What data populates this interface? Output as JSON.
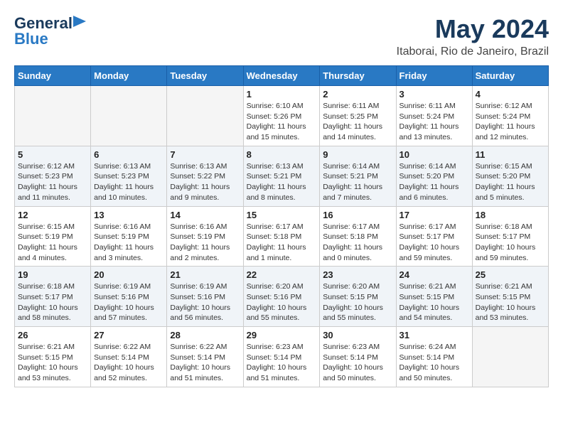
{
  "header": {
    "logo_general": "General",
    "logo_blue": "Blue",
    "title": "May 2024",
    "subtitle": "Itaborai, Rio de Janeiro, Brazil"
  },
  "weekdays": [
    "Sunday",
    "Monday",
    "Tuesday",
    "Wednesday",
    "Thursday",
    "Friday",
    "Saturday"
  ],
  "weeks": [
    [
      {
        "day": "",
        "sunrise": "",
        "sunset": "",
        "daylight": ""
      },
      {
        "day": "",
        "sunrise": "",
        "sunset": "",
        "daylight": ""
      },
      {
        "day": "",
        "sunrise": "",
        "sunset": "",
        "daylight": ""
      },
      {
        "day": "1",
        "sunrise": "Sunrise: 6:10 AM",
        "sunset": "Sunset: 5:26 PM",
        "daylight": "Daylight: 11 hours and 15 minutes."
      },
      {
        "day": "2",
        "sunrise": "Sunrise: 6:11 AM",
        "sunset": "Sunset: 5:25 PM",
        "daylight": "Daylight: 11 hours and 14 minutes."
      },
      {
        "day": "3",
        "sunrise": "Sunrise: 6:11 AM",
        "sunset": "Sunset: 5:24 PM",
        "daylight": "Daylight: 11 hours and 13 minutes."
      },
      {
        "day": "4",
        "sunrise": "Sunrise: 6:12 AM",
        "sunset": "Sunset: 5:24 PM",
        "daylight": "Daylight: 11 hours and 12 minutes."
      }
    ],
    [
      {
        "day": "5",
        "sunrise": "Sunrise: 6:12 AM",
        "sunset": "Sunset: 5:23 PM",
        "daylight": "Daylight: 11 hours and 11 minutes."
      },
      {
        "day": "6",
        "sunrise": "Sunrise: 6:13 AM",
        "sunset": "Sunset: 5:23 PM",
        "daylight": "Daylight: 11 hours and 10 minutes."
      },
      {
        "day": "7",
        "sunrise": "Sunrise: 6:13 AM",
        "sunset": "Sunset: 5:22 PM",
        "daylight": "Daylight: 11 hours and 9 minutes."
      },
      {
        "day": "8",
        "sunrise": "Sunrise: 6:13 AM",
        "sunset": "Sunset: 5:21 PM",
        "daylight": "Daylight: 11 hours and 8 minutes."
      },
      {
        "day": "9",
        "sunrise": "Sunrise: 6:14 AM",
        "sunset": "Sunset: 5:21 PM",
        "daylight": "Daylight: 11 hours and 7 minutes."
      },
      {
        "day": "10",
        "sunrise": "Sunrise: 6:14 AM",
        "sunset": "Sunset: 5:20 PM",
        "daylight": "Daylight: 11 hours and 6 minutes."
      },
      {
        "day": "11",
        "sunrise": "Sunrise: 6:15 AM",
        "sunset": "Sunset: 5:20 PM",
        "daylight": "Daylight: 11 hours and 5 minutes."
      }
    ],
    [
      {
        "day": "12",
        "sunrise": "Sunrise: 6:15 AM",
        "sunset": "Sunset: 5:19 PM",
        "daylight": "Daylight: 11 hours and 4 minutes."
      },
      {
        "day": "13",
        "sunrise": "Sunrise: 6:16 AM",
        "sunset": "Sunset: 5:19 PM",
        "daylight": "Daylight: 11 hours and 3 minutes."
      },
      {
        "day": "14",
        "sunrise": "Sunrise: 6:16 AM",
        "sunset": "Sunset: 5:19 PM",
        "daylight": "Daylight: 11 hours and 2 minutes."
      },
      {
        "day": "15",
        "sunrise": "Sunrise: 6:17 AM",
        "sunset": "Sunset: 5:18 PM",
        "daylight": "Daylight: 11 hours and 1 minute."
      },
      {
        "day": "16",
        "sunrise": "Sunrise: 6:17 AM",
        "sunset": "Sunset: 5:18 PM",
        "daylight": "Daylight: 11 hours and 0 minutes."
      },
      {
        "day": "17",
        "sunrise": "Sunrise: 6:17 AM",
        "sunset": "Sunset: 5:17 PM",
        "daylight": "Daylight: 10 hours and 59 minutes."
      },
      {
        "day": "18",
        "sunrise": "Sunrise: 6:18 AM",
        "sunset": "Sunset: 5:17 PM",
        "daylight": "Daylight: 10 hours and 59 minutes."
      }
    ],
    [
      {
        "day": "19",
        "sunrise": "Sunrise: 6:18 AM",
        "sunset": "Sunset: 5:17 PM",
        "daylight": "Daylight: 10 hours and 58 minutes."
      },
      {
        "day": "20",
        "sunrise": "Sunrise: 6:19 AM",
        "sunset": "Sunset: 5:16 PM",
        "daylight": "Daylight: 10 hours and 57 minutes."
      },
      {
        "day": "21",
        "sunrise": "Sunrise: 6:19 AM",
        "sunset": "Sunset: 5:16 PM",
        "daylight": "Daylight: 10 hours and 56 minutes."
      },
      {
        "day": "22",
        "sunrise": "Sunrise: 6:20 AM",
        "sunset": "Sunset: 5:16 PM",
        "daylight": "Daylight: 10 hours and 55 minutes."
      },
      {
        "day": "23",
        "sunrise": "Sunrise: 6:20 AM",
        "sunset": "Sunset: 5:15 PM",
        "daylight": "Daylight: 10 hours and 55 minutes."
      },
      {
        "day": "24",
        "sunrise": "Sunrise: 6:21 AM",
        "sunset": "Sunset: 5:15 PM",
        "daylight": "Daylight: 10 hours and 54 minutes."
      },
      {
        "day": "25",
        "sunrise": "Sunrise: 6:21 AM",
        "sunset": "Sunset: 5:15 PM",
        "daylight": "Daylight: 10 hours and 53 minutes."
      }
    ],
    [
      {
        "day": "26",
        "sunrise": "Sunrise: 6:21 AM",
        "sunset": "Sunset: 5:15 PM",
        "daylight": "Daylight: 10 hours and 53 minutes."
      },
      {
        "day": "27",
        "sunrise": "Sunrise: 6:22 AM",
        "sunset": "Sunset: 5:14 PM",
        "daylight": "Daylight: 10 hours and 52 minutes."
      },
      {
        "day": "28",
        "sunrise": "Sunrise: 6:22 AM",
        "sunset": "Sunset: 5:14 PM",
        "daylight": "Daylight: 10 hours and 51 minutes."
      },
      {
        "day": "29",
        "sunrise": "Sunrise: 6:23 AM",
        "sunset": "Sunset: 5:14 PM",
        "daylight": "Daylight: 10 hours and 51 minutes."
      },
      {
        "day": "30",
        "sunrise": "Sunrise: 6:23 AM",
        "sunset": "Sunset: 5:14 PM",
        "daylight": "Daylight: 10 hours and 50 minutes."
      },
      {
        "day": "31",
        "sunrise": "Sunrise: 6:24 AM",
        "sunset": "Sunset: 5:14 PM",
        "daylight": "Daylight: 10 hours and 50 minutes."
      },
      {
        "day": "",
        "sunrise": "",
        "sunset": "",
        "daylight": ""
      }
    ]
  ]
}
